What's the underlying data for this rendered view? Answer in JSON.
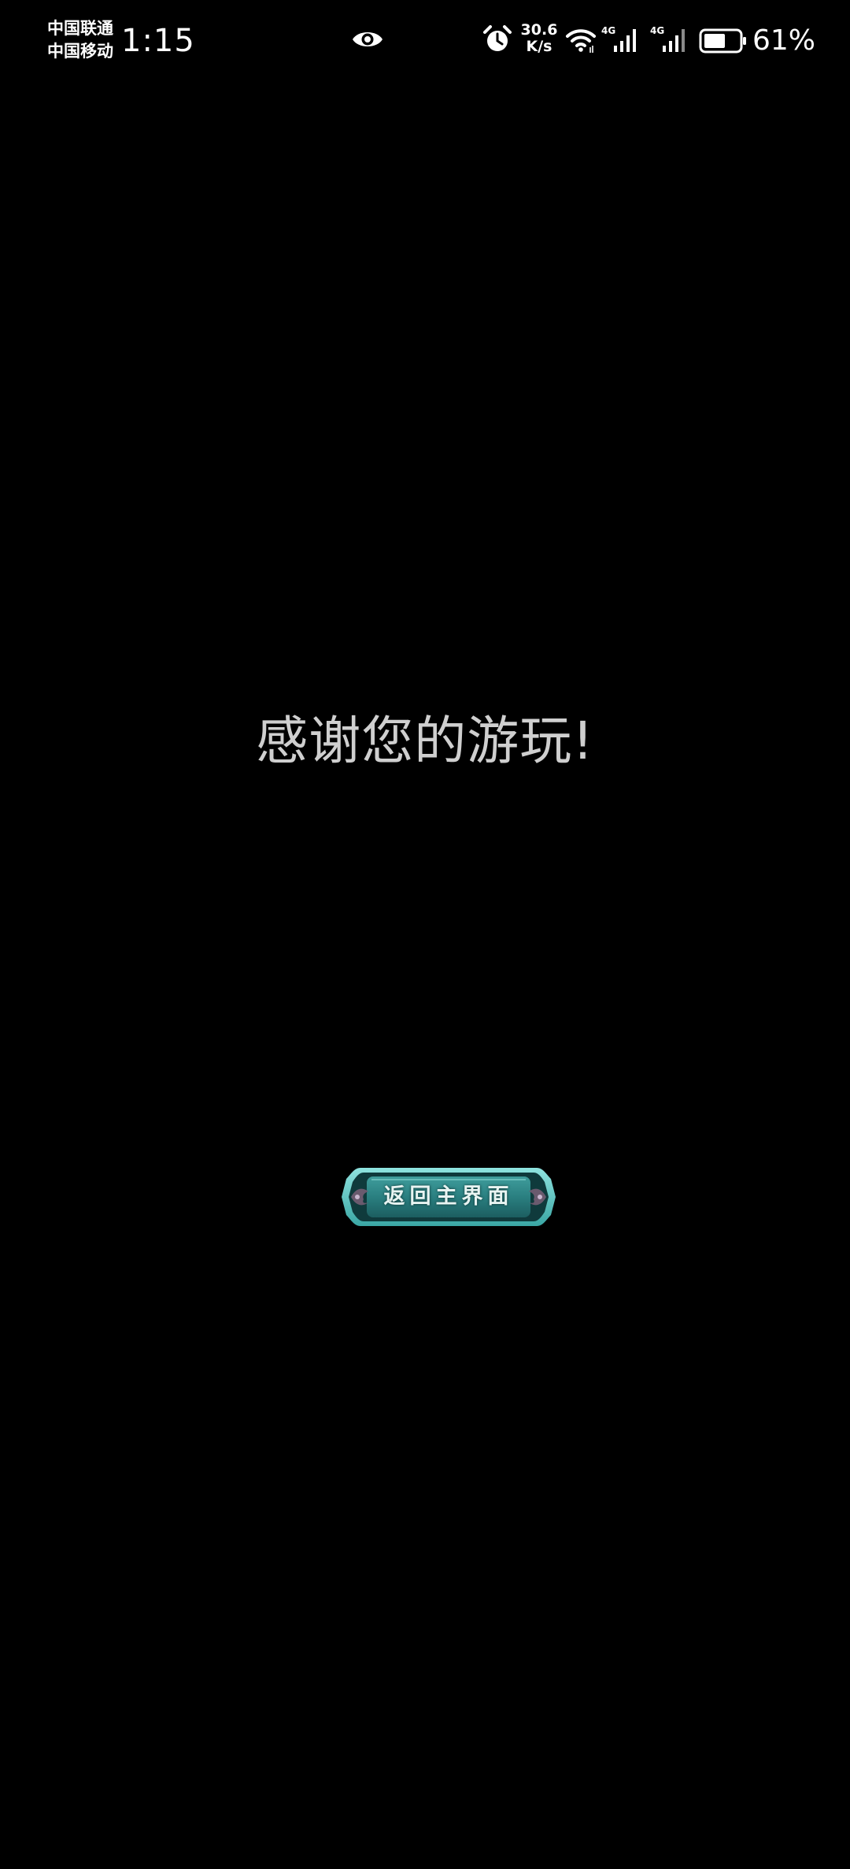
{
  "status_bar": {
    "carrier_1": "中国联通",
    "carrier_2": "中国移动",
    "time": "1:15",
    "net_speed_value": "30.6",
    "net_speed_unit": "K/s",
    "sim1_type": "4G",
    "sim2_type": "4G",
    "battery_level": 0.61,
    "battery_percent": "61%",
    "icons": [
      "eye-icon",
      "alarm-icon",
      "wifi-icon",
      "signal-icon",
      "signal-icon",
      "battery-icon"
    ]
  },
  "main": {
    "message": "感谢您的游玩!",
    "return_button_label": "返回主界面"
  },
  "colors": {
    "background": "#000000",
    "message_text": "#cfcfcf",
    "button_teal": "#2a7f80",
    "button_frame": "#5fc9c6"
  }
}
